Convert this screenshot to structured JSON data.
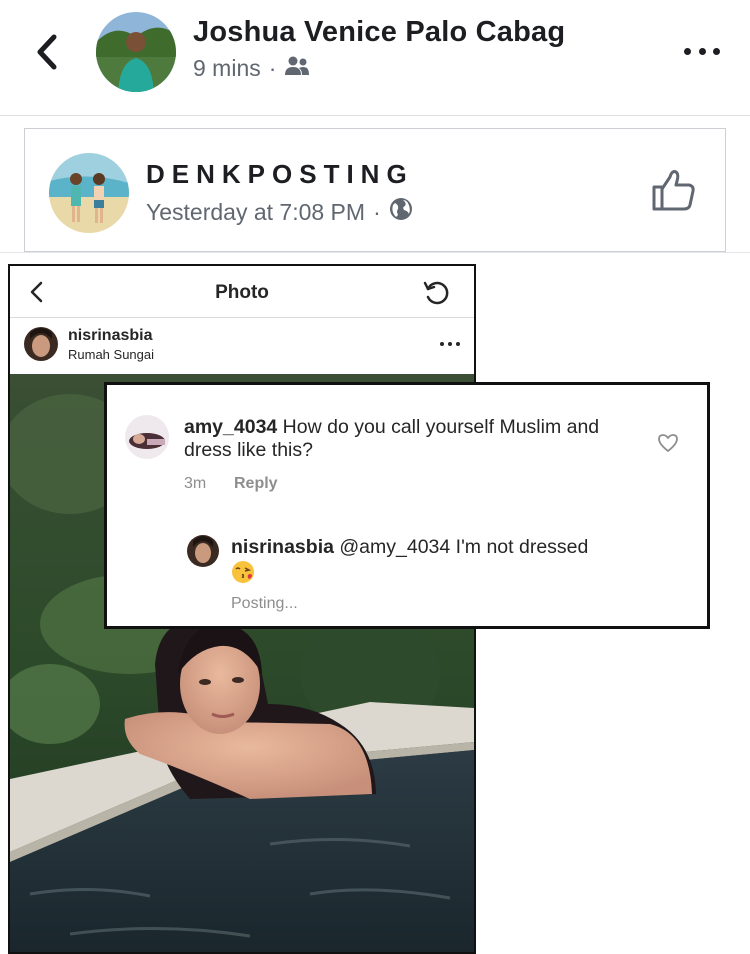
{
  "post": {
    "author_name": "Joshua Venice Palo Cabag",
    "time": "9 mins",
    "separator": "·",
    "audience_icon": "friends-icon"
  },
  "shared_page": {
    "name": "DENKPOSTING",
    "time": "Yesterday at 7:08 PM",
    "separator": "·",
    "audience_icon": "globe-icon"
  },
  "instagram": {
    "header_title": "Photo",
    "username": "nisrinasbia",
    "location": "Rumah Sungai"
  },
  "comments": {
    "comment1_user": "amy_4034",
    "comment1_text": " How do you call yourself Muslim and dress like this?",
    "comment1_time": "3m",
    "comment1_reply": "Reply",
    "comment2_user": "nisrinasbia",
    "comment2_text": " @amy_4034 I'm not dressed",
    "comment2_status": "Posting..."
  },
  "colors": {
    "text": "#1c1e21",
    "meta": "#606770",
    "ig_meta": "#8e8e8e"
  }
}
